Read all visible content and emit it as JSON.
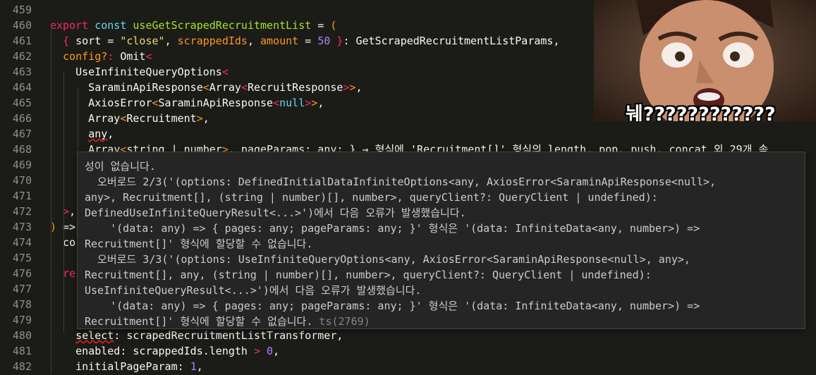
{
  "editor": {
    "lines": [
      {
        "n": "459",
        "segments": []
      },
      {
        "n": "460",
        "segments": [
          [
            "kw",
            "export"
          ],
          [
            "par",
            " "
          ],
          [
            "kw2",
            "const"
          ],
          [
            "par",
            " "
          ],
          [
            "fn",
            "useGetScrapedRecruitmentList"
          ],
          [
            "par",
            " = "
          ],
          [
            "or",
            "("
          ]
        ]
      },
      {
        "n": "461",
        "segments": [
          [
            "par",
            "  "
          ],
          [
            "pink",
            "{"
          ],
          [
            "par",
            " sort = "
          ],
          [
            "str",
            "\"close\""
          ],
          [
            "par",
            ", "
          ],
          [
            "or",
            "scrappedIds"
          ],
          [
            "par",
            ", "
          ],
          [
            "or",
            "amount"
          ],
          [
            "par",
            " = "
          ],
          [
            "num",
            "50"
          ],
          [
            "par",
            " "
          ],
          [
            "pink",
            "}"
          ],
          [
            "par",
            ": GetScrapedRecruitmentListParams,"
          ]
        ]
      },
      {
        "n": "462",
        "segments": [
          [
            "par",
            "  "
          ],
          [
            "or",
            "config?"
          ],
          [
            "pink",
            ":"
          ],
          [
            "par",
            " Omit"
          ],
          [
            "pink",
            "<"
          ]
        ]
      },
      {
        "n": "463",
        "segments": [
          [
            "par",
            "    UseInfiniteQueryOptions"
          ],
          [
            "pink",
            "<"
          ]
        ]
      },
      {
        "n": "464",
        "segments": [
          [
            "par",
            "      SaraminApiResponse"
          ],
          [
            "or",
            "<"
          ],
          [
            "par",
            "Array"
          ],
          [
            "pink",
            "<"
          ],
          [
            "par",
            "RecruitResponse"
          ],
          [
            "pink",
            ">"
          ],
          [
            "or",
            ">"
          ],
          [
            "par",
            ","
          ]
        ]
      },
      {
        "n": "465",
        "segments": [
          [
            "par",
            "      AxiosError"
          ],
          [
            "or",
            "<"
          ],
          [
            "par",
            "SaraminApiResponse"
          ],
          [
            "pink",
            "<"
          ],
          [
            "kw2",
            "null"
          ],
          [
            "pink",
            ">"
          ],
          [
            "or",
            ">"
          ],
          [
            "par",
            ","
          ]
        ]
      },
      {
        "n": "466",
        "segments": [
          [
            "par",
            "      Array"
          ],
          [
            "or",
            "<"
          ],
          [
            "par",
            "Recruitment"
          ],
          [
            "or",
            ">"
          ],
          [
            "par",
            ","
          ]
        ]
      },
      {
        "n": "467",
        "segments": [
          [
            "par",
            "      "
          ],
          [
            "sq",
            "any"
          ],
          [
            "par",
            ","
          ]
        ]
      },
      {
        "n": "468",
        "segments": [
          [
            "par",
            "      Array"
          ],
          [
            "or",
            "<"
          ],
          [
            "par",
            "string | number"
          ],
          [
            "or",
            ">"
          ],
          [
            "par",
            ", pageParams: any; } → 형식에 'Recruitment[]' 형식의 length, pop, push, concat 외 29개 속"
          ]
        ]
      },
      {
        "n": "469",
        "segments": []
      },
      {
        "n": "470",
        "segments": []
      },
      {
        "n": "471",
        "segments": []
      },
      {
        "n": "472",
        "segments": [
          [
            "pink",
            "  >"
          ],
          [
            "par",
            ","
          ]
        ]
      },
      {
        "n": "473",
        "segments": [
          [
            "or",
            ")"
          ],
          [
            "par",
            " =>"
          ]
        ]
      },
      {
        "n": "474",
        "segments": [
          [
            "par",
            "  co"
          ]
        ]
      },
      {
        "n": "475",
        "segments": []
      },
      {
        "n": "476",
        "segments": [
          [
            "par",
            "  "
          ],
          [
            "pink",
            "re"
          ]
        ]
      },
      {
        "n": "477",
        "segments": []
      },
      {
        "n": "478",
        "segments": []
      },
      {
        "n": "479",
        "segments": []
      },
      {
        "n": "480",
        "segments": [
          [
            "par",
            "    "
          ],
          [
            "sq",
            "select"
          ],
          [
            "par",
            ": scrapedRecruitmentListTransformer,"
          ]
        ]
      },
      {
        "n": "481",
        "segments": [
          [
            "par",
            "    enabled: scrappedIds.length "
          ],
          [
            "pink",
            ">"
          ],
          [
            "par",
            " "
          ],
          [
            "num",
            "0"
          ],
          [
            "par",
            ","
          ]
        ]
      },
      {
        "n": "482",
        "segments": [
          [
            "par",
            "    initialPageParam: "
          ],
          [
            "num",
            "1"
          ],
          [
            "par",
            ","
          ]
        ]
      }
    ]
  },
  "tooltip": {
    "lines": [
      "성이 없습니다.",
      "  오버로드 2/3('(options: DefinedInitialDataInfiniteOptions<any, AxiosError<SaraminApiResponse<null>,",
      "any>, Recruitment[], (string | number)[], number>, queryClient?: QueryClient | undefined):",
      "DefinedUseInfiniteQueryResult<...>')에서 다음 오류가 발생했습니다.",
      "    '(data: any) => { pages: any; pageParams: any; }' 형식은 '(data: InfiniteData<any, number>) =>",
      "Recruitment[]' 형식에 할당할 수 없습니다.",
      "  오버로드 3/3('(options: UseInfiniteQueryOptions<any, AxiosError<SaraminApiResponse<null>, any>,",
      "Recruitment[], any, (string | number)[], number>, queryClient?: QueryClient | undefined):",
      "UseInfiniteQueryResult<...>')에서 다음 오류가 발생했습니다.",
      "    '(data: any) => { pages: any; pageParams: any; }' 형식은 '(data: InfiniteData<any, number>) =>",
      "Recruitment[]' 형식에 할당할 수 없습니다."
    ],
    "code": "ts(2769)"
  },
  "meme": {
    "caption": "눼????????????"
  }
}
